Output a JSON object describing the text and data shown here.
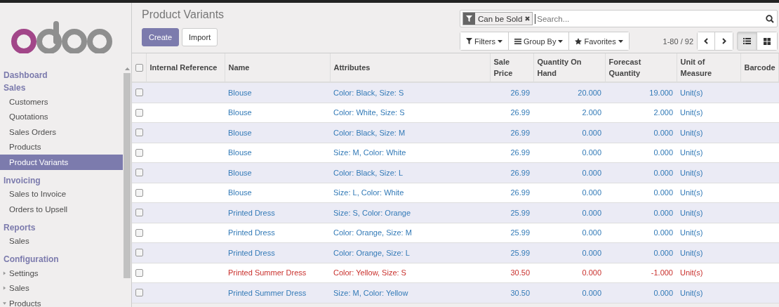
{
  "sidebar": {
    "sections": [
      {
        "title": "Dashboard"
      },
      {
        "title": "Sales",
        "items": [
          {
            "label": "Customers",
            "selected": false
          },
          {
            "label": "Quotations",
            "selected": false
          },
          {
            "label": "Sales Orders",
            "selected": false
          },
          {
            "label": "Products",
            "selected": false
          },
          {
            "label": "Product Variants",
            "selected": true
          }
        ]
      },
      {
        "title": "Invoicing",
        "items": [
          {
            "label": "Sales to Invoice",
            "selected": false
          },
          {
            "label": "Orders to Upsell",
            "selected": false
          }
        ]
      },
      {
        "title": "Reports",
        "items": [
          {
            "label": "Sales",
            "selected": false
          }
        ]
      },
      {
        "title": "Configuration",
        "items": [
          {
            "label": "Settings",
            "selected": false,
            "expanded": false
          },
          {
            "label": "Sales",
            "selected": false,
            "expanded": false
          },
          {
            "label": "Products",
            "selected": false,
            "expanded": true
          }
        ]
      }
    ]
  },
  "page_title": "Product Variants",
  "buttons": {
    "create": "Create",
    "import": "Import"
  },
  "search": {
    "facet": "Can be Sold",
    "placeholder": "Search..."
  },
  "search_options": [
    "Filters",
    "Group By",
    "Favorites"
  ],
  "pager": "1-80 / 92",
  "view_switcher": [
    {
      "kind": "list",
      "selected": true
    },
    {
      "kind": "kanban",
      "selected": false
    }
  ],
  "table": {
    "select_all_checked": false,
    "columns": [
      "Internal Reference",
      "Name",
      "Attributes",
      "Sale Price",
      "Quantity On Hand",
      "Forecast Quantity",
      "Unit of Measure",
      "Barcode"
    ],
    "rows": [
      {
        "name": "Blouse",
        "attributes": "Color: Black, Size: S",
        "price": "26.99",
        "on_hand": "20.000",
        "forecast": "19.000",
        "uom": "Unit(s)",
        "shortage": false,
        "checked": false
      },
      {
        "name": "Blouse",
        "attributes": "Color: White, Size: S",
        "price": "26.99",
        "on_hand": "2.000",
        "forecast": "2.000",
        "uom": "Unit(s)",
        "shortage": false,
        "checked": false
      },
      {
        "name": "Blouse",
        "attributes": "Color: Black, Size: M",
        "price": "26.99",
        "on_hand": "0.000",
        "forecast": "0.000",
        "uom": "Unit(s)",
        "shortage": false,
        "checked": false
      },
      {
        "name": "Blouse",
        "attributes": "Size: M, Color: White",
        "price": "26.99",
        "on_hand": "0.000",
        "forecast": "0.000",
        "uom": "Unit(s)",
        "shortage": false,
        "checked": false
      },
      {
        "name": "Blouse",
        "attributes": "Color: Black, Size: L",
        "price": "26.99",
        "on_hand": "0.000",
        "forecast": "0.000",
        "uom": "Unit(s)",
        "shortage": false,
        "checked": false
      },
      {
        "name": "Blouse",
        "attributes": "Size: L, Color: White",
        "price": "26.99",
        "on_hand": "0.000",
        "forecast": "0.000",
        "uom": "Unit(s)",
        "shortage": false,
        "checked": false
      },
      {
        "name": "Printed Dress",
        "attributes": "Size: S, Color: Orange",
        "price": "25.99",
        "on_hand": "0.000",
        "forecast": "0.000",
        "uom": "Unit(s)",
        "shortage": false,
        "checked": false
      },
      {
        "name": "Printed Dress",
        "attributes": "Color: Orange, Size: M",
        "price": "25.99",
        "on_hand": "0.000",
        "forecast": "0.000",
        "uom": "Unit(s)",
        "shortage": false,
        "checked": false
      },
      {
        "name": "Printed Dress",
        "attributes": "Color: Orange, Size: L",
        "price": "25.99",
        "on_hand": "0.000",
        "forecast": "0.000",
        "uom": "Unit(s)",
        "shortage": false,
        "checked": false
      },
      {
        "name": "Printed Summer Dress",
        "attributes": "Color: Yellow, Size: S",
        "price": "30.50",
        "on_hand": "0.000",
        "forecast": "-1.000",
        "uom": "Unit(s)",
        "shortage": true,
        "checked": false
      },
      {
        "name": "Printed Summer Dress",
        "attributes": "Size: M, Color: Yellow",
        "price": "30.50",
        "on_hand": "0.000",
        "forecast": "0.000",
        "uom": "Unit(s)",
        "shortage": false,
        "checked": false
      }
    ]
  }
}
